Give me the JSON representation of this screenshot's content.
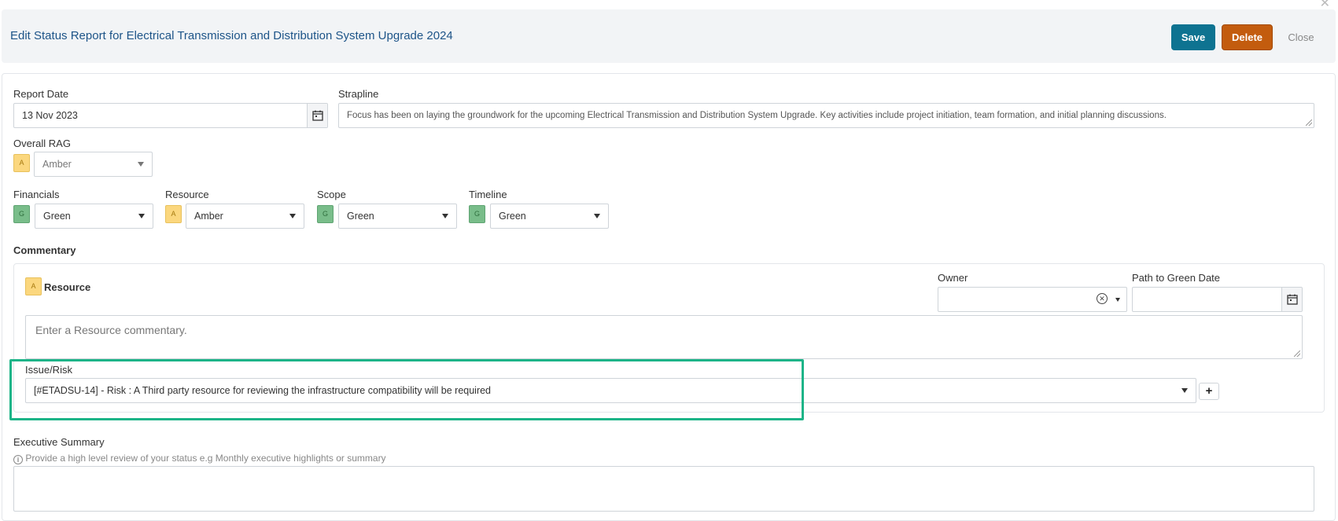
{
  "header": {
    "title": "Edit Status Report for Electrical Transmission and Distribution System Upgrade 2024",
    "save_label": "Save",
    "delete_label": "Delete",
    "close_label": "Close"
  },
  "report_date": {
    "label": "Report Date",
    "value": "13 Nov 2023"
  },
  "strapline": {
    "label": "Strapline",
    "value": "Focus has been on laying the groundwork for the upcoming Electrical Transmission and Distribution System Upgrade. Key activities include project initiation, team formation, and initial planning discussions."
  },
  "overall_rag": {
    "label": "Overall RAG",
    "chip": "A",
    "value": "Amber"
  },
  "rag_fields": [
    {
      "label": "Financials",
      "chip": "G",
      "value": "Green"
    },
    {
      "label": "Resource",
      "chip": "A",
      "value": "Amber"
    },
    {
      "label": "Scope",
      "chip": "G",
      "value": "Green"
    },
    {
      "label": "Timeline",
      "chip": "G",
      "value": "Green"
    }
  ],
  "commentary": {
    "heading": "Commentary",
    "section_chip": "A",
    "section_title": "Resource",
    "owner_label": "Owner",
    "owner_value": "",
    "path_label": "Path to Green Date",
    "path_value": "",
    "comment_placeholder": "Enter a Resource commentary.",
    "issue_label": "Issue/Risk",
    "issue_value": "[#ETADSU-14] - Risk : A Third party resource for reviewing the infrastructure compatibility will be required",
    "add_label": "+"
  },
  "executive_summary": {
    "label": "Executive Summary",
    "hint": "Provide a high level review of your status e.g Monthly executive highlights or summary",
    "value": ""
  },
  "colors": {
    "save": "#0e7391",
    "delete": "#c35c0e",
    "amber": "#fbd77e",
    "green": "#79bd8a",
    "highlight": "#1db488",
    "title": "#1d5488"
  }
}
